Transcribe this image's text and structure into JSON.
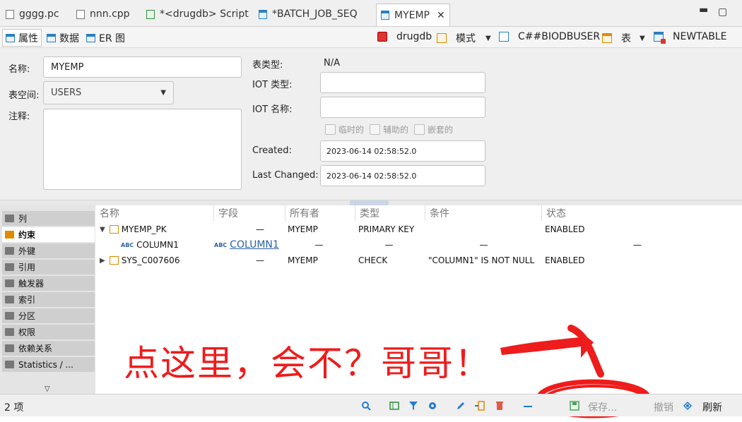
{
  "editor_tabs": [
    {
      "label": "gggg.pc",
      "icon": "file-icon",
      "active": false
    },
    {
      "label": "nnn.cpp",
      "icon": "file-icon",
      "active": false
    },
    {
      "label": "*<drugdb> Script",
      "icon": "script-icon",
      "active": false
    },
    {
      "label": "*BATCH_JOB_SEQ",
      "icon": "table-icon",
      "active": false
    },
    {
      "label": "MYEMP",
      "icon": "table-icon",
      "active": true
    }
  ],
  "window_controls": {
    "minimize": "▬",
    "maximize": "▢"
  },
  "sub_tabs": [
    {
      "label": "属性",
      "active": true
    },
    {
      "label": "数据",
      "active": false
    },
    {
      "label": "ER 图",
      "active": false
    }
  ],
  "breadcrumb": {
    "database": "drugdb",
    "schema_label": "模式",
    "schema": "C##BIODBUSER",
    "tables_label": "表",
    "table": "NEWTABLE"
  },
  "properties": {
    "name_label": "名称:",
    "name_value": "MYEMP",
    "tablespace_label": "表空间:",
    "tablespace_value": "USERS",
    "comment_label": "注释:",
    "table_type_label": "表类型:",
    "table_type_value": "N/A",
    "iot_type_label": "IOT 类型:",
    "iot_name_label": "IOT 名称:",
    "temporary_label": "临时的",
    "secondary_label": "辅助的",
    "nested_label": "嵌套的",
    "created_label": "Created:",
    "created_value": "2023-06-14  02:58:52.0",
    "last_changed_label": "Last Changed:",
    "last_changed_value": "2023-06-14  02:58:52.0"
  },
  "nav_items": [
    {
      "label": "列",
      "active": false
    },
    {
      "label": "约束",
      "active": true
    },
    {
      "label": "外键",
      "active": false
    },
    {
      "label": "引用",
      "active": false
    },
    {
      "label": "触发器",
      "active": false
    },
    {
      "label": "索引",
      "active": false
    },
    {
      "label": "分区",
      "active": false
    },
    {
      "label": "权限",
      "active": false
    },
    {
      "label": "依赖关系",
      "active": false
    },
    {
      "label": "Statistics / ...",
      "active": false
    }
  ],
  "nav_more": "▽",
  "constraints_table": {
    "headers": [
      "名称",
      "字段",
      "所有者",
      "类型",
      "条件",
      "状态"
    ],
    "rows": [
      {
        "expander": "▼",
        "name": "MYEMP_PK",
        "field": "—",
        "owner": "MYEMP",
        "type": "PRIMARY KEY",
        "condition": "",
        "status": "ENABLED"
      },
      {
        "expander": "",
        "name": "COLUMN1",
        "field": "COLUMN1",
        "owner": "—",
        "type": "—",
        "condition": "—",
        "status": "—"
      },
      {
        "expander": "▶",
        "name": "SYS_C007606",
        "field": "—",
        "owner": "MYEMP",
        "type": "CHECK",
        "condition": "\"COLUMN1\" IS NOT NULL",
        "status": "ENABLED"
      }
    ]
  },
  "annotation_text": "点这里，会不？哥哥！",
  "status_bar": {
    "count": "2 项",
    "save_label": "保存...",
    "cancel_label": "撤销",
    "refresh_label": "刷新"
  },
  "colors": {
    "accent_blue": "#2a7fc1",
    "annotation_red": "#ee1c1c",
    "schema_orange": "#e08a00"
  }
}
